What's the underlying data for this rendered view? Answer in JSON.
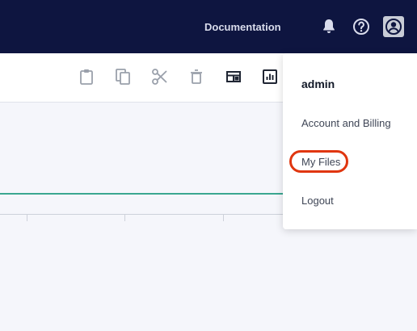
{
  "header": {
    "documentation_label": "Documentation",
    "icons": [
      "notifications-icon",
      "help-icon",
      "user-avatar-icon"
    ]
  },
  "toolbar": {
    "tools": [
      "paste-icon",
      "copy-icon",
      "cut-icon",
      "delete-icon",
      "layout-icon",
      "chart-icon"
    ]
  },
  "user_menu": {
    "username": "admin",
    "items": [
      {
        "label": "Account and Billing"
      },
      {
        "label": "My Files"
      },
      {
        "label": "Logout"
      }
    ]
  },
  "colors": {
    "header_bg": "#0e1540",
    "accent_line": "#3aa790",
    "highlight": "#e0360f"
  }
}
